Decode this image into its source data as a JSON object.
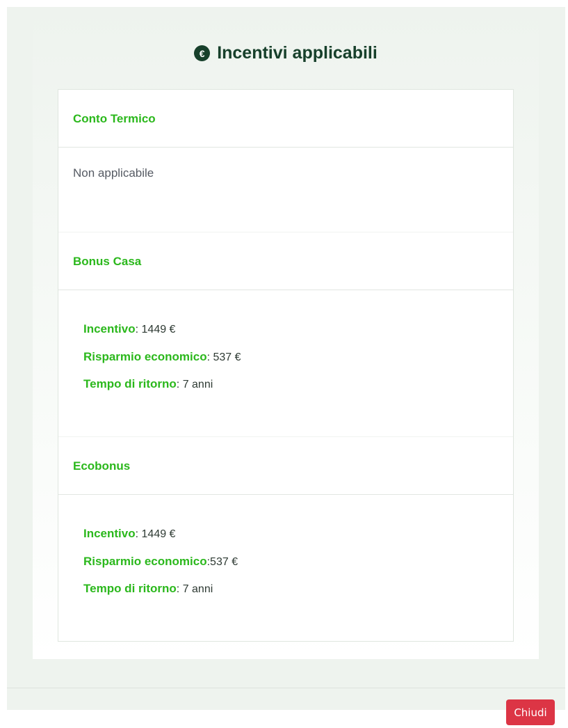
{
  "modal": {
    "title": "Incentivi applicabili",
    "title_icon": "euro-coin-icon",
    "title_icon_glyph": "€"
  },
  "incentives": [
    {
      "name": "Conto Termico",
      "status": "Non applicabile"
    },
    {
      "name": "Bonus Casa",
      "incentive_label": "Incentivo",
      "incentive_value": ": 1449 €",
      "saving_label": "Risparmio economico",
      "saving_value": ": 537 €",
      "payback_label": "Tempo di ritorno",
      "payback_value": ": 7 anni"
    },
    {
      "name": "Ecobonus",
      "incentive_label": "Incentivo",
      "incentive_value": ": 1449 €",
      "saving_label": "Risparmio economico",
      "saving_value": ":537 €",
      "payback_label": "Tempo di ritorno",
      "payback_value": ": 7 anni"
    }
  ],
  "footer": {
    "close_label": "Chiudi"
  },
  "colors": {
    "accent_green": "#2bb81c",
    "title_dark_green": "#17402b",
    "close_red": "#dc3545",
    "modal_bg": "#eef3ee"
  }
}
